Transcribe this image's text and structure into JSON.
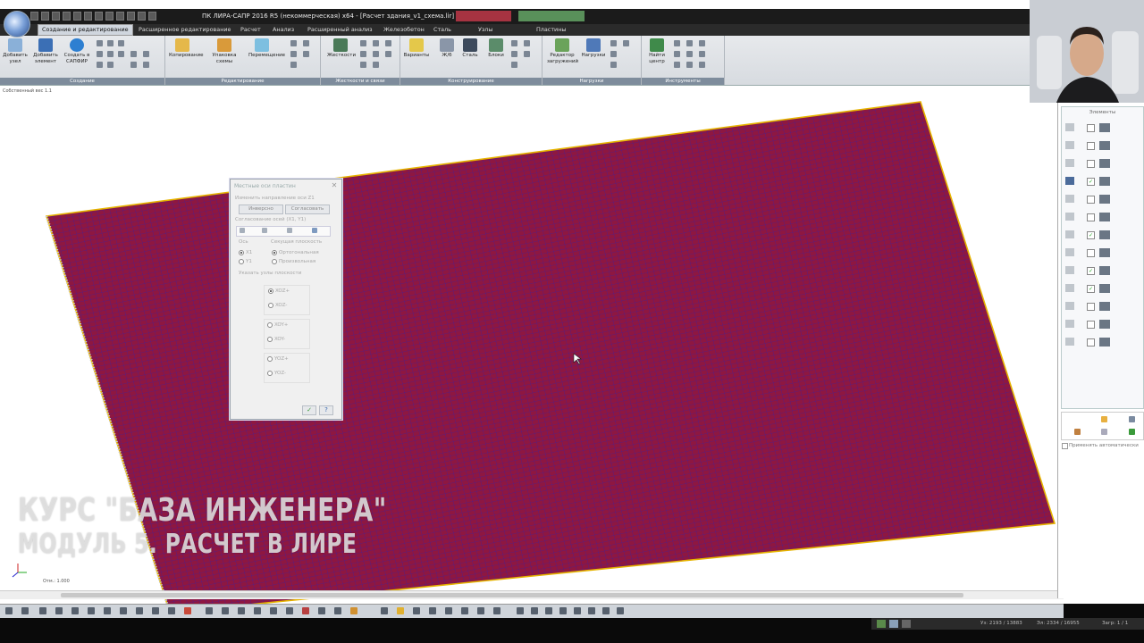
{
  "window": {
    "title": "ПК ЛИРА-САПР  2016 R5 (некоммерческая) x64 - [Расчет здания_v1_схема.lir]"
  },
  "tabs": [
    {
      "label": "Создание и редактирование",
      "active": true
    },
    {
      "label": "Расширенное редактирование"
    },
    {
      "label": "Расчет"
    },
    {
      "label": "Анализ"
    },
    {
      "label": "Расширенный анализ"
    },
    {
      "label": "Железобетон"
    },
    {
      "label": "Сталь"
    },
    {
      "label": "Узлы"
    },
    {
      "label": "Пластины"
    }
  ],
  "ribbon": {
    "groups": {
      "create": "Создание",
      "edit": "Редактирование",
      "stiffness": "Жесткости и связи",
      "design": "Конструирование",
      "loads": "Нагрузки",
      "tools": "Инструменты"
    },
    "buttons": {
      "add_node": "Добавить узел",
      "add_element": "Добавить элемент",
      "create_sapfir": "Создать в САПФИР",
      "copy": "Копирование",
      "pack_scheme": "Упаковка схемы",
      "move": "Перемещение",
      "stiffness": "Жесткости",
      "variants": "Варианты",
      "rc": "Ж/б",
      "steel": "Сталь",
      "blocks": "Блоки",
      "load_editor": "Редактор загружений",
      "loads": "Нагрузки",
      "find_center": "Найти центр"
    }
  },
  "viewport": {
    "label": "Собственный вес 1.1",
    "scale": "Отм.: 1.000",
    "colors": {
      "plate": "#8e1741",
      "mesh": "#2d1fa0",
      "edge": "#e6b400"
    }
  },
  "dialog": {
    "title": "Местные оси пластин",
    "change_dir_label": "Изменить направление оси Z1",
    "invert_button": "Инверсно",
    "match_button": "Согласовать",
    "align_label": "Согласование осей (X1, Y1)",
    "axis_label": "Ось",
    "plane_label": "Секущая плоскость",
    "axis_x1": "X1",
    "axis_y1": "Y1",
    "plane_ortho": "Ортогональная",
    "plane_arbitrary": "Произвольная",
    "specify_nodes": "Указать узлы плоскости",
    "options": [
      "XOZ+",
      "XOZ-",
      "XOY+",
      "XOY-",
      "YOZ+",
      "YOZ-"
    ],
    "selected_option": "XOZ+",
    "apply_icon": "check-icon",
    "help_icon": "question-icon"
  },
  "right_panel": {
    "title": "Элементы",
    "auto_apply": "Применять автоматически"
  },
  "overlay": {
    "line1": "КУРС \"БАЗА ИНЖЕНЕРА\"",
    "line2": "МОДУЛЬ 5. РАСЧЕТ В ЛИРЕ"
  },
  "status": {
    "coords_a": "Уз: 2193 / 13883",
    "coords_b": "Эл: 2334 / 16955",
    "sheets": "Загр: 1 / 1"
  }
}
